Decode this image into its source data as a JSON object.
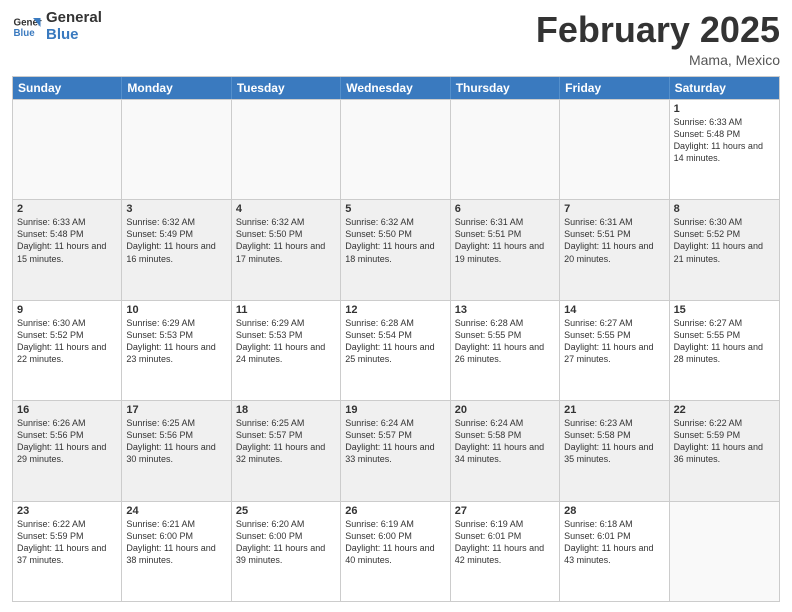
{
  "logo": {
    "line1": "General",
    "line2": "Blue"
  },
  "title": "February 2025",
  "subtitle": "Mama, Mexico",
  "days": [
    "Sunday",
    "Monday",
    "Tuesday",
    "Wednesday",
    "Thursday",
    "Friday",
    "Saturday"
  ],
  "weeks": [
    [
      {
        "day": "",
        "info": ""
      },
      {
        "day": "",
        "info": ""
      },
      {
        "day": "",
        "info": ""
      },
      {
        "day": "",
        "info": ""
      },
      {
        "day": "",
        "info": ""
      },
      {
        "day": "",
        "info": ""
      },
      {
        "day": "1",
        "info": "Sunrise: 6:33 AM\nSunset: 5:48 PM\nDaylight: 11 hours and 14 minutes."
      }
    ],
    [
      {
        "day": "2",
        "info": "Sunrise: 6:33 AM\nSunset: 5:48 PM\nDaylight: 11 hours and 15 minutes."
      },
      {
        "day": "3",
        "info": "Sunrise: 6:32 AM\nSunset: 5:49 PM\nDaylight: 11 hours and 16 minutes."
      },
      {
        "day": "4",
        "info": "Sunrise: 6:32 AM\nSunset: 5:50 PM\nDaylight: 11 hours and 17 minutes."
      },
      {
        "day": "5",
        "info": "Sunrise: 6:32 AM\nSunset: 5:50 PM\nDaylight: 11 hours and 18 minutes."
      },
      {
        "day": "6",
        "info": "Sunrise: 6:31 AM\nSunset: 5:51 PM\nDaylight: 11 hours and 19 minutes."
      },
      {
        "day": "7",
        "info": "Sunrise: 6:31 AM\nSunset: 5:51 PM\nDaylight: 11 hours and 20 minutes."
      },
      {
        "day": "8",
        "info": "Sunrise: 6:30 AM\nSunset: 5:52 PM\nDaylight: 11 hours and 21 minutes."
      }
    ],
    [
      {
        "day": "9",
        "info": "Sunrise: 6:30 AM\nSunset: 5:52 PM\nDaylight: 11 hours and 22 minutes."
      },
      {
        "day": "10",
        "info": "Sunrise: 6:29 AM\nSunset: 5:53 PM\nDaylight: 11 hours and 23 minutes."
      },
      {
        "day": "11",
        "info": "Sunrise: 6:29 AM\nSunset: 5:53 PM\nDaylight: 11 hours and 24 minutes."
      },
      {
        "day": "12",
        "info": "Sunrise: 6:28 AM\nSunset: 5:54 PM\nDaylight: 11 hours and 25 minutes."
      },
      {
        "day": "13",
        "info": "Sunrise: 6:28 AM\nSunset: 5:55 PM\nDaylight: 11 hours and 26 minutes."
      },
      {
        "day": "14",
        "info": "Sunrise: 6:27 AM\nSunset: 5:55 PM\nDaylight: 11 hours and 27 minutes."
      },
      {
        "day": "15",
        "info": "Sunrise: 6:27 AM\nSunset: 5:55 PM\nDaylight: 11 hours and 28 minutes."
      }
    ],
    [
      {
        "day": "16",
        "info": "Sunrise: 6:26 AM\nSunset: 5:56 PM\nDaylight: 11 hours and 29 minutes."
      },
      {
        "day": "17",
        "info": "Sunrise: 6:25 AM\nSunset: 5:56 PM\nDaylight: 11 hours and 30 minutes."
      },
      {
        "day": "18",
        "info": "Sunrise: 6:25 AM\nSunset: 5:57 PM\nDaylight: 11 hours and 32 minutes."
      },
      {
        "day": "19",
        "info": "Sunrise: 6:24 AM\nSunset: 5:57 PM\nDaylight: 11 hours and 33 minutes."
      },
      {
        "day": "20",
        "info": "Sunrise: 6:24 AM\nSunset: 5:58 PM\nDaylight: 11 hours and 34 minutes."
      },
      {
        "day": "21",
        "info": "Sunrise: 6:23 AM\nSunset: 5:58 PM\nDaylight: 11 hours and 35 minutes."
      },
      {
        "day": "22",
        "info": "Sunrise: 6:22 AM\nSunset: 5:59 PM\nDaylight: 11 hours and 36 minutes."
      }
    ],
    [
      {
        "day": "23",
        "info": "Sunrise: 6:22 AM\nSunset: 5:59 PM\nDaylight: 11 hours and 37 minutes."
      },
      {
        "day": "24",
        "info": "Sunrise: 6:21 AM\nSunset: 6:00 PM\nDaylight: 11 hours and 38 minutes."
      },
      {
        "day": "25",
        "info": "Sunrise: 6:20 AM\nSunset: 6:00 PM\nDaylight: 11 hours and 39 minutes."
      },
      {
        "day": "26",
        "info": "Sunrise: 6:19 AM\nSunset: 6:00 PM\nDaylight: 11 hours and 40 minutes."
      },
      {
        "day": "27",
        "info": "Sunrise: 6:19 AM\nSunset: 6:01 PM\nDaylight: 11 hours and 42 minutes."
      },
      {
        "day": "28",
        "info": "Sunrise: 6:18 AM\nSunset: 6:01 PM\nDaylight: 11 hours and 43 minutes."
      },
      {
        "day": "",
        "info": ""
      }
    ]
  ]
}
